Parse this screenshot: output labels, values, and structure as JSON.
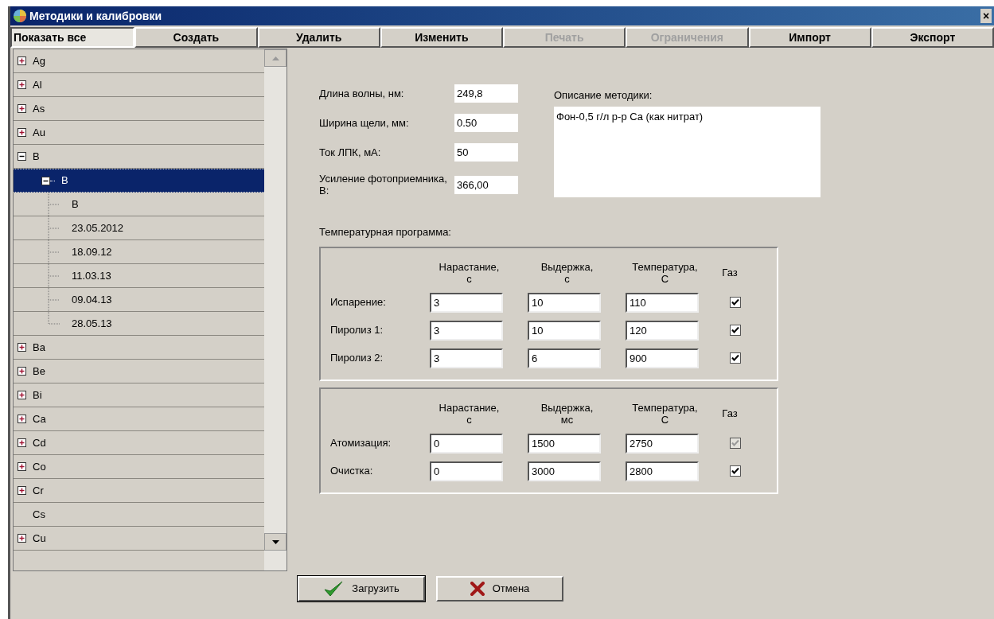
{
  "window": {
    "title": "Методики и калибровки",
    "close": "×"
  },
  "toolbar": [
    {
      "label": "Показать все",
      "selected": true,
      "disabled": false
    },
    {
      "label": "Создать",
      "selected": false,
      "disabled": false
    },
    {
      "label": "Удалить",
      "selected": false,
      "disabled": false
    },
    {
      "label": "Изменить",
      "selected": false,
      "disabled": false
    },
    {
      "label": "Печать",
      "selected": false,
      "disabled": true
    },
    {
      "label": "Ограничения",
      "selected": false,
      "disabled": true
    },
    {
      "label": "Импорт",
      "selected": false,
      "disabled": false
    },
    {
      "label": "Экспорт",
      "selected": false,
      "disabled": false
    }
  ],
  "tree": {
    "items": [
      {
        "label": "Ag",
        "expanded": false,
        "selected": false
      },
      {
        "label": "Al",
        "expanded": false,
        "selected": false
      },
      {
        "label": "As",
        "expanded": false,
        "selected": false
      },
      {
        "label": "Au",
        "expanded": false,
        "selected": false
      },
      {
        "label": "B",
        "expanded": true,
        "selected": false,
        "children": [
          {
            "label": "B",
            "expanded": true,
            "selected": true,
            "children": [
              {
                "label": "B",
                "selected": false
              },
              {
                "label": "23.05.2012",
                "selected": false
              },
              {
                "label": "18.09.12",
                "selected": false
              },
              {
                "label": "11.03.13",
                "selected": false
              },
              {
                "label": "09.04.13",
                "selected": false
              },
              {
                "label": "28.05.13",
                "selected": false
              }
            ]
          }
        ]
      },
      {
        "label": "Ba",
        "expanded": false,
        "selected": false
      },
      {
        "label": "Be",
        "expanded": false,
        "selected": false
      },
      {
        "label": "Bi",
        "expanded": false,
        "selected": false
      },
      {
        "label": "Ca",
        "expanded": false,
        "selected": false
      },
      {
        "label": "Cd",
        "expanded": false,
        "selected": false
      },
      {
        "label": "Co",
        "expanded": false,
        "selected": false
      },
      {
        "label": "Cr",
        "expanded": false,
        "selected": false
      },
      {
        "label": "Cs",
        "selected": false
      },
      {
        "label": "Cu",
        "expanded": false,
        "selected": false
      }
    ]
  },
  "params": [
    {
      "label": "Длина волны, нм:",
      "value": "249,8"
    },
    {
      "label": "Ширина щели, мм:",
      "value": "0.50"
    },
    {
      "label": "Ток ЛПК, мА:",
      "value": "50"
    },
    {
      "label": "Усиление фотоприемника, В:",
      "value": "366,00"
    }
  ],
  "description": {
    "label": "Описание методики:",
    "value": "Фон-0,5 г/л р-р Ca (как нитрат)"
  },
  "temperature_program": {
    "label": "Температурная программа:",
    "groups": [
      {
        "columns": [
          [
            "Нарастание,",
            "с"
          ],
          [
            "Выдержка,",
            "с"
          ],
          [
            "Температура,",
            "С"
          ],
          [
            "Газ"
          ]
        ],
        "rows": [
          {
            "label": "Испарение:",
            "values": [
              "3",
              "10",
              "110"
            ],
            "gas": true,
            "gas_disabled": false
          },
          {
            "label": "Пиролиз 1:",
            "values": [
              "3",
              "10",
              "120"
            ],
            "gas": true,
            "gas_disabled": false
          },
          {
            "label": "Пиролиз 2:",
            "values": [
              "3",
              "6",
              "900"
            ],
            "gas": true,
            "gas_disabled": false
          }
        ]
      },
      {
        "columns": [
          [
            "Нарастание,",
            "с"
          ],
          [
            "Выдержка,",
            "мс"
          ],
          [
            "Температура,",
            "С"
          ],
          [
            "Газ"
          ]
        ],
        "rows": [
          {
            "label": "Атомизация:",
            "values": [
              "0",
              "1500",
              "2750"
            ],
            "gas": true,
            "gas_disabled": true
          },
          {
            "label": "Очистка:",
            "values": [
              "0",
              "3000",
              "2800"
            ],
            "gas": true,
            "gas_disabled": false
          }
        ]
      }
    ]
  },
  "buttons": [
    {
      "label": "Загрузить",
      "kind": "ok",
      "default": true
    },
    {
      "label": "Отмена",
      "kind": "cancel",
      "default": false
    }
  ]
}
